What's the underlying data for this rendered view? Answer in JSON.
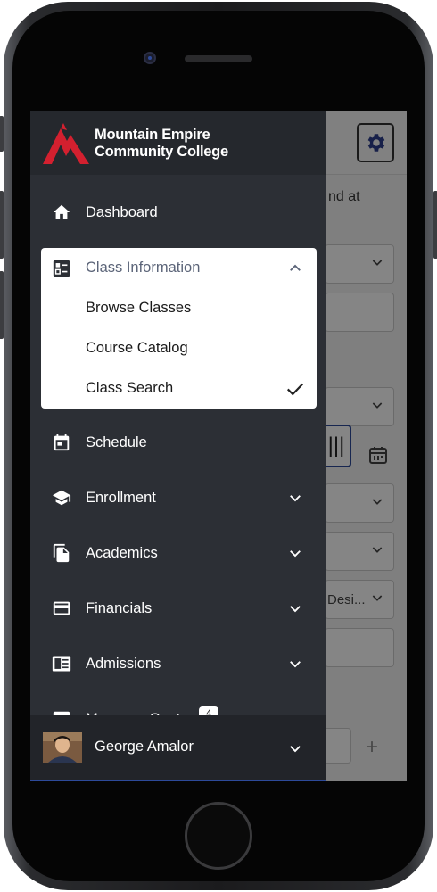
{
  "college": {
    "name_line1": "Mountain Empire",
    "name_line2": "Community College",
    "logo_icon": "mountain-logo-icon",
    "logo_color": "#d3202f"
  },
  "nav": {
    "dashboard": {
      "label": "Dashboard",
      "icon": "home-icon"
    },
    "class_information": {
      "label": "Class Information",
      "icon": "list-icon",
      "expanded": true,
      "sub_items": [
        {
          "label": "Browse Classes"
        },
        {
          "label": "Course Catalog"
        },
        {
          "label": "Class Search",
          "selected": true
        }
      ]
    },
    "schedule": {
      "label": "Schedule",
      "icon": "calendar-icon"
    },
    "enrollment": {
      "label": "Enrollment",
      "icon": "graduation-cap-icon"
    },
    "academics": {
      "label": "Academics",
      "icon": "documents-icon"
    },
    "financials": {
      "label": "Financials",
      "icon": "credit-card-icon"
    },
    "admissions": {
      "label": "Admissions",
      "icon": "newspaper-icon"
    },
    "messages": {
      "label": "Message Center",
      "badge": "4",
      "icon": "mail-icon"
    }
  },
  "user": {
    "name": "George Amalor"
  },
  "background": {
    "text_fragment": "nd at",
    "dropdown_fragment": "Desi..."
  },
  "colors": {
    "drawer_bg": "#2c2f35",
    "header_bg": "#25282d",
    "accent_blue": "#2d4a9a"
  }
}
